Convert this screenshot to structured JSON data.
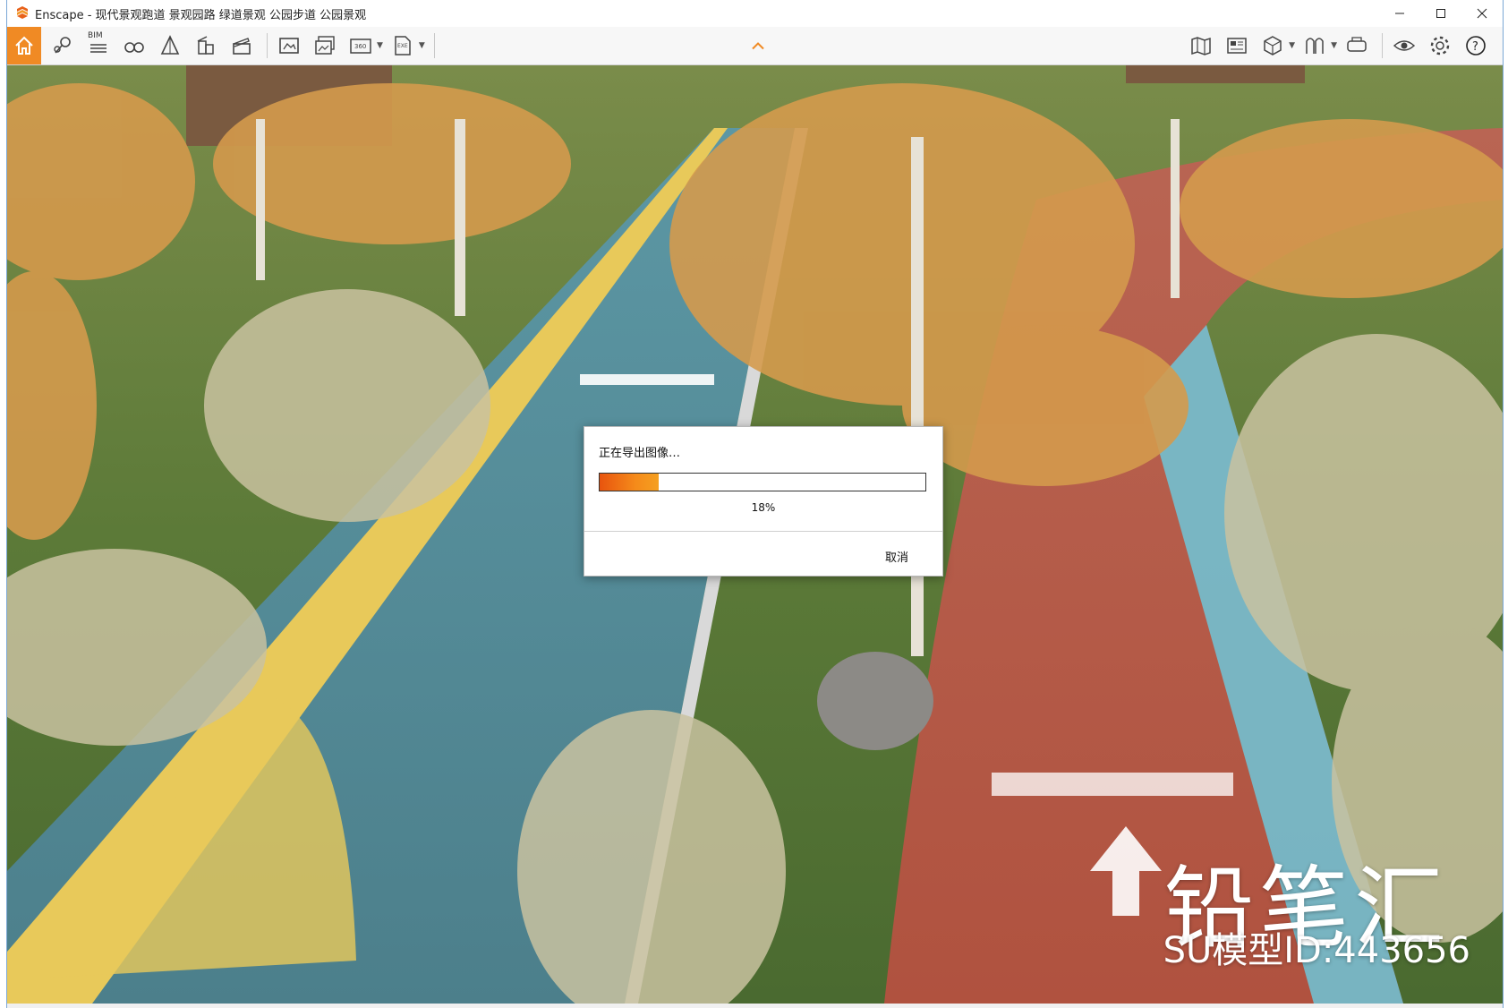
{
  "window": {
    "app_name": "Enscape",
    "title": "Enscape - 现代景观跑道 景观园路 绿道景观 公园步道 公园景观"
  },
  "toolbar": {
    "bim_label": "BIM",
    "icons": [
      "home-icon",
      "pin-icon",
      "bim-icon",
      "binoculars-icon",
      "perspective-icon",
      "building-icon",
      "clapper-icon",
      "render-icon",
      "batch-render-icon",
      "panorama-360-icon",
      "exe-export-icon"
    ],
    "right_icons": [
      "map-icon",
      "asset-library-icon",
      "cube-icon",
      "material-icon",
      "vr-headset-icon",
      "visibility-icon",
      "settings-icon",
      "help-icon"
    ]
  },
  "dialog": {
    "title": "正在导出图像…",
    "progress_percent": 18,
    "progress_label": "18%",
    "cancel_label": "取消"
  },
  "watermark": {
    "brand": "铅笔汇",
    "model_id": "SU模型ID:443656"
  },
  "colors": {
    "accent": "#f08a24",
    "progress_start": "#e8540e",
    "progress_end": "#f5a020",
    "blue_track": "#4f8a96",
    "red_track": "#b5584a"
  }
}
